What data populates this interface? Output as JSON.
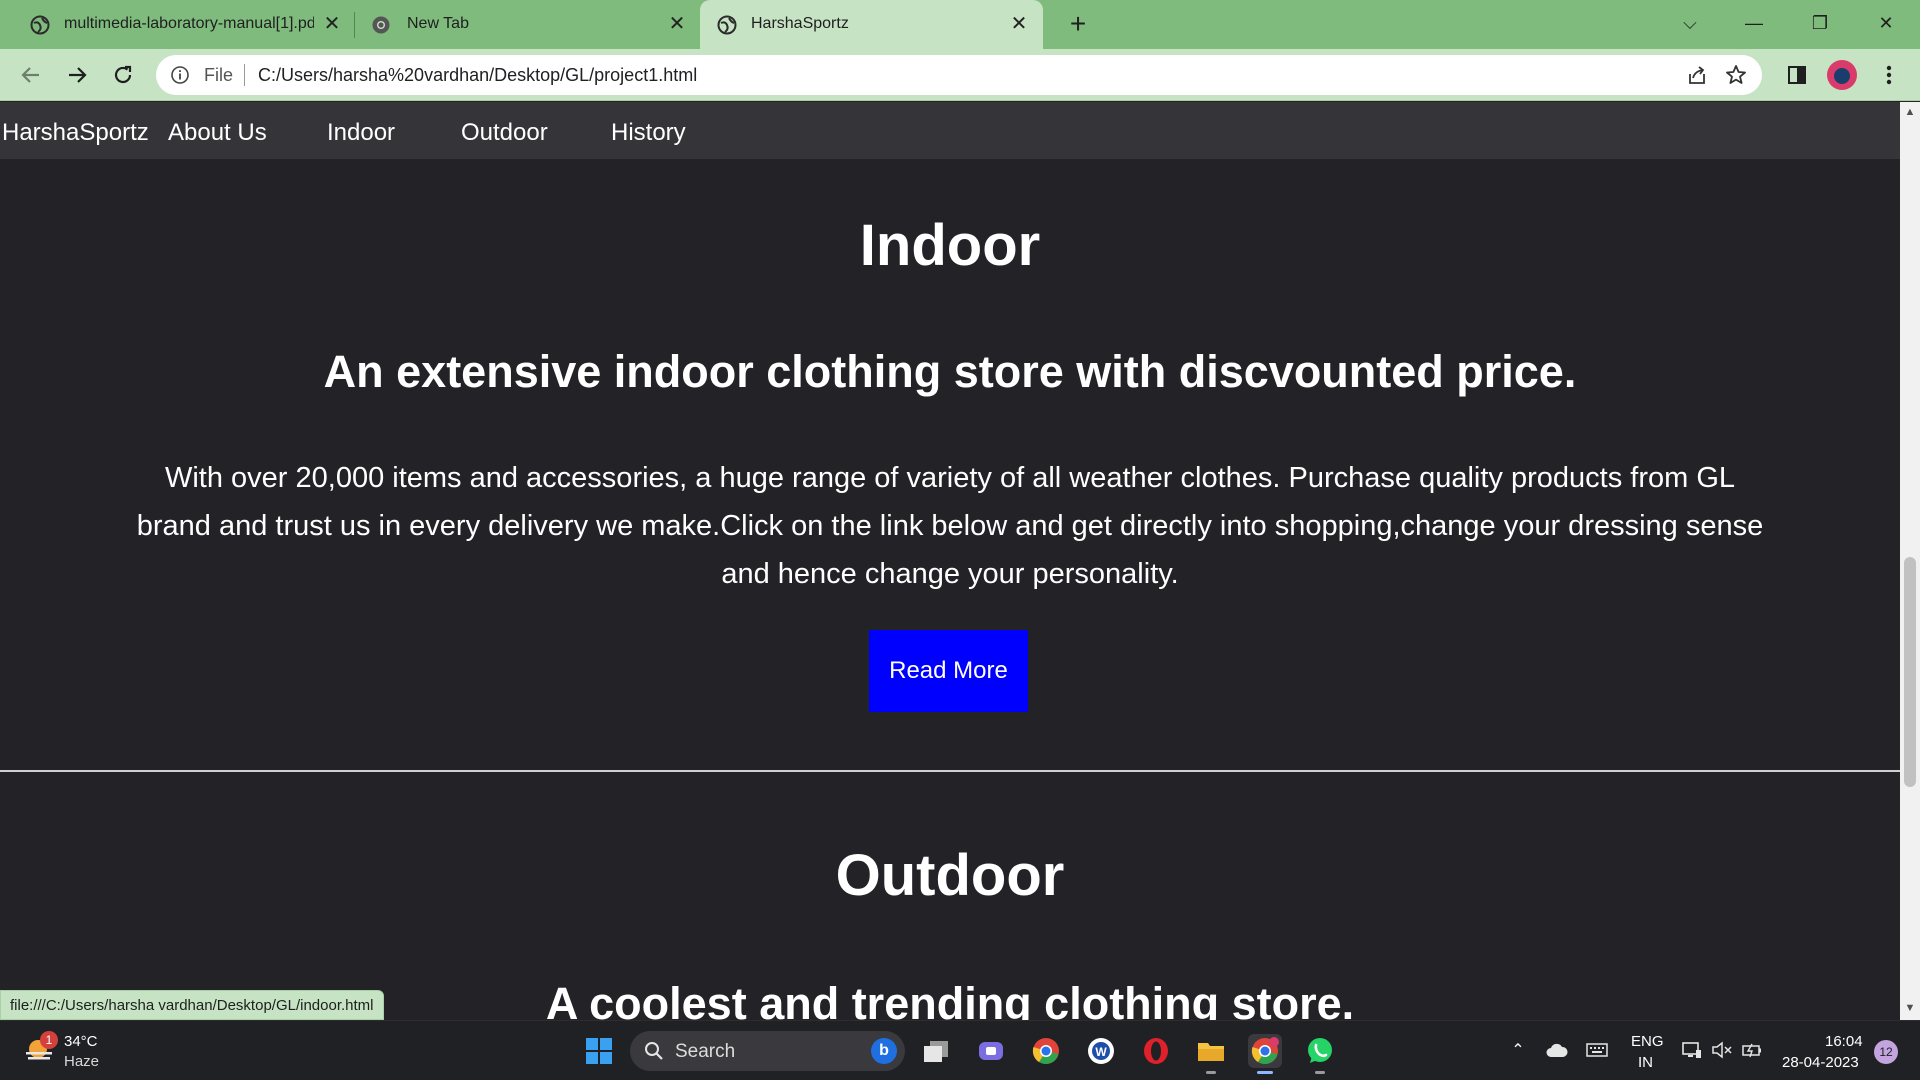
{
  "browser": {
    "tabs": [
      {
        "title": "multimedia-laboratory-manual[1].pdf",
        "close_icon": "close-icon"
      },
      {
        "title": "New Tab",
        "close_icon": "close-icon"
      },
      {
        "title": "HarshaSportz",
        "close_icon": "close-icon"
      }
    ],
    "address": {
      "scheme_label": "File",
      "url": "C:/Users/harsha%20vardhan/Desktop/GL/project1.html"
    },
    "status_tooltip": "file:///C:/Users/harsha vardhan/Desktop/GL/indoor.html"
  },
  "page": {
    "nav": {
      "brand": "HarshaSportz",
      "links": [
        "About Us",
        "Indoor",
        "Outdoor",
        "History"
      ]
    },
    "indoor": {
      "heading": "Indoor",
      "subheading": "An extensive indoor clothing store with discvounted price.",
      "paragraph_lines": [
        "With over 20,000 items and accessories, a huge range of variety of all weather clothes. Purchase quality products from GL",
        "brand and trust us in every delivery we make.Click on the link below and get directly into shopping,change your dressing sense",
        "and hence change your personality."
      ],
      "button": "Read More",
      "button_color": "#0000ff"
    },
    "outdoor": {
      "heading": "Outdoor",
      "subheading": "A coolest and trending clothing store."
    },
    "background_color": "#232227",
    "navbar_color": "#353539"
  },
  "taskbar": {
    "weather": {
      "temp": "34°C",
      "condition": "Haze",
      "badge": "1"
    },
    "search_placeholder": "Search",
    "language": {
      "line1": "ENG",
      "line2": "IN"
    },
    "clock": {
      "time": "16:04",
      "date": "28-04-2023"
    },
    "notification_count": "12"
  }
}
